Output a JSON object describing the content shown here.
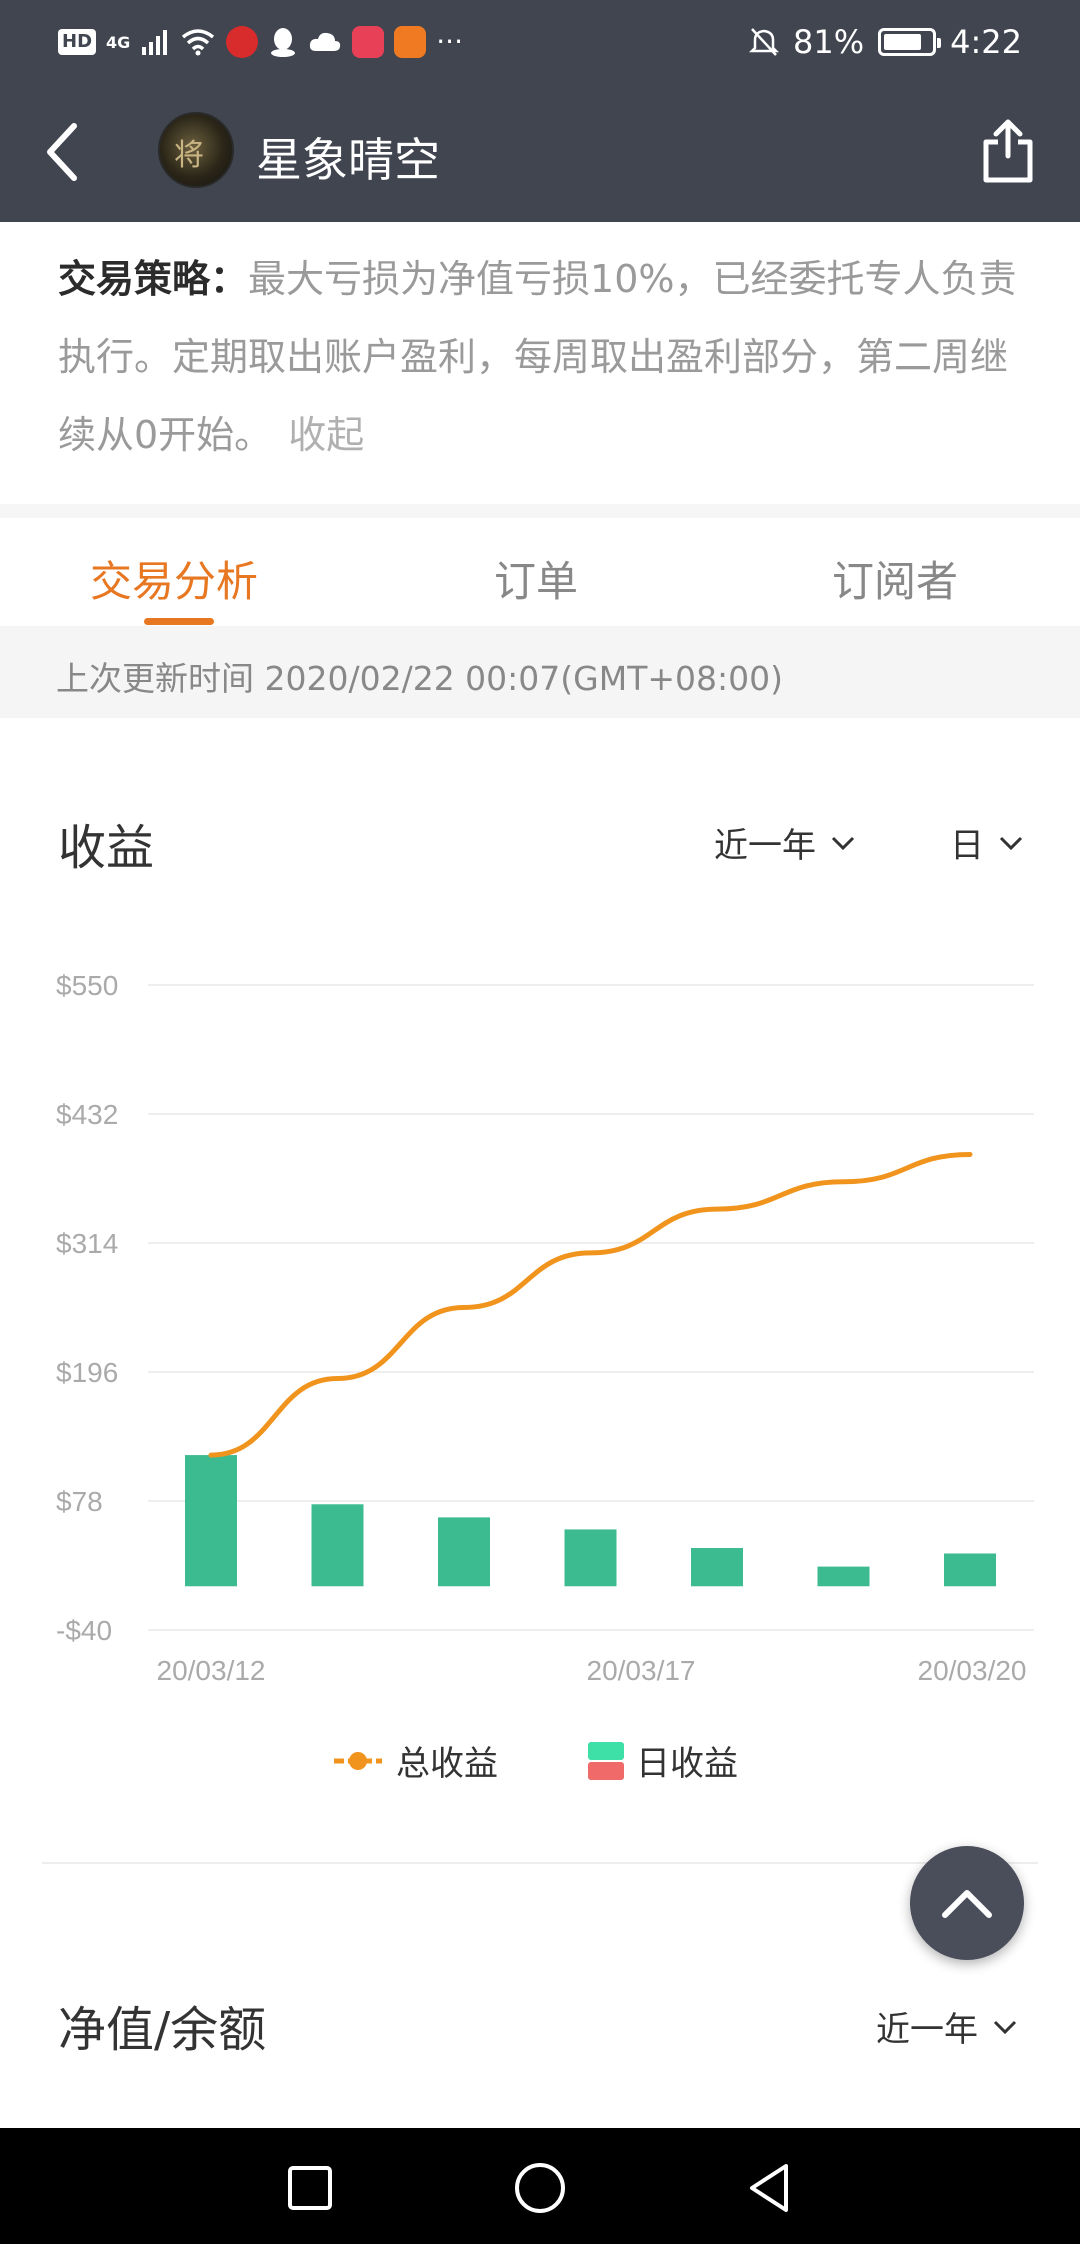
{
  "status_bar": {
    "hd": "HD",
    "network": "4G",
    "battery": "81%",
    "battery_level": 0.81,
    "time": "4:22",
    "more": "···"
  },
  "nav": {
    "title": "星象晴空",
    "avatar_glyph": "将"
  },
  "strategy": {
    "label": "交易策略：",
    "text": "最大亏损为净值亏损10%，已经委托专人负责执行。定期取出账户盈利，每周取出盈利部分，第二周继续从0开始。",
    "collapse": "收起"
  },
  "tabs": [
    {
      "label": "交易分析",
      "active": true
    },
    {
      "label": "订单",
      "active": false
    },
    {
      "label": "订阅者",
      "active": false
    }
  ],
  "update_time": "上次更新时间 2020/02/22 00:07(GMT+08:00)",
  "income": {
    "title": "收益",
    "range": "近一年",
    "period": "日"
  },
  "networth": {
    "title": "净值/余额",
    "range": "近一年"
  },
  "colors": {
    "header_bg": "#404550",
    "accent": "#e87722",
    "bar_positive": "#3dbb90",
    "bar_negative": "#f06a6a",
    "line": "#f0941e"
  },
  "chart_data": {
    "type": "bar",
    "y_ticks": [
      "$550",
      "$432",
      "$314",
      "$196",
      "$78",
      "-$40"
    ],
    "ylim": [
      -40,
      550
    ],
    "x_tick_labels": [
      "20/03/12",
      "20/03/17",
      "20/03/20"
    ],
    "series": [
      {
        "name": "总收益",
        "kind": "line",
        "values": [
          120,
          190,
          255,
          305,
          345,
          370,
          395
        ]
      },
      {
        "name": "日收益",
        "kind": "bar",
        "values": [
          120,
          75,
          63,
          52,
          35,
          18,
          30
        ]
      }
    ],
    "legend": [
      "总收益",
      "日收益"
    ],
    "grid": true,
    "legend_position": "bottom"
  }
}
